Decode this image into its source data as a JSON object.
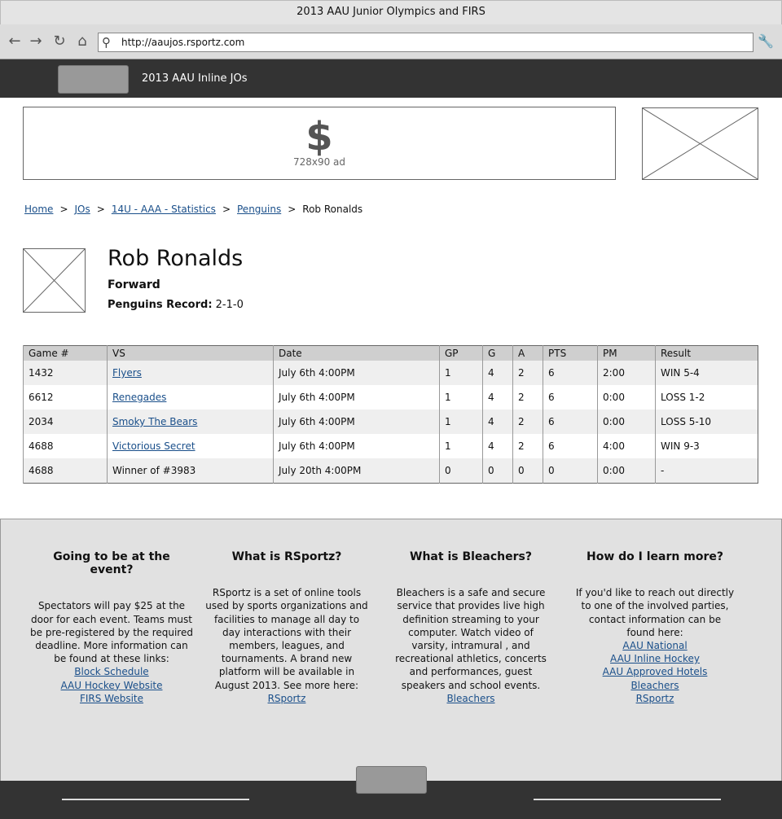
{
  "window": {
    "title": "2013 AAU Junior Olympics and FIRS"
  },
  "browser": {
    "url": "http://aaujos.rsportz.com"
  },
  "header": {
    "app_title": "2013 AAU Inline JOs"
  },
  "ads": {
    "banner_label": "728x90 ad",
    "banner_symbol": "$"
  },
  "breadcrumb": {
    "items": [
      "Home",
      "JOs",
      "14U - AAA - Statistics",
      "Penguins"
    ],
    "current": "Rob Ronalds",
    "separator": ">"
  },
  "player": {
    "name": "Rob Ronalds",
    "position": "Forward",
    "record_label": "Penguins Record:",
    "record_value": "2-1-0"
  },
  "stats_table": {
    "columns": [
      "Game #",
      "VS",
      "Date",
      "GP",
      "G",
      "A",
      "PTS",
      "PM",
      "Result"
    ],
    "rows": [
      [
        "1432",
        "Flyers",
        "July 6th 4:00PM",
        "1",
        "4",
        "2",
        "6",
        "2:00",
        "WIN 5-4"
      ],
      [
        "6612",
        "Renegades",
        "July 6th 4:00PM",
        "1",
        "4",
        "2",
        "6",
        "0:00",
        "LOSS 1-2"
      ],
      [
        "2034",
        "Smoky The Bears",
        "July 6th 4:00PM",
        "1",
        "4",
        "2",
        "6",
        "0:00",
        "LOSS 5-10"
      ],
      [
        "4688",
        "Victorious Secret",
        "July 6th 4:00PM",
        "1",
        "4",
        "2",
        "6",
        "4:00",
        "WIN 9-3"
      ],
      [
        "4688",
        "Winner of #3983",
        "July 20th 4:00PM",
        "0",
        "0",
        "0",
        "0",
        "0:00",
        "-"
      ]
    ]
  },
  "footer": {
    "event": {
      "title": "Going to be at the event?",
      "body": "Spectators will pay $25 at the door for each event.  Teams must be pre-registered by the required deadline.  More information can be found at these links:",
      "links": [
        "Block Schedule",
        "AAU Hockey Website",
        "FIRS Website"
      ]
    },
    "rsportz": {
      "title": "What is RSportz?",
      "body": "RSportz is a set of online tools used by sports organizations and facilities to manage all day to day interactions with their members, leagues, and tournaments.  A brand new platform will be available in August 2013.  See more here:",
      "links": [
        "RSportz"
      ]
    },
    "bleachers": {
      "title": "What is Bleachers?",
      "body": "Bleachers is a safe and secure service that provides live high definition streaming to your computer.  Watch video of varsity, intramural , and recreational athletics, concerts and performances, guest speakers and school events.",
      "links": [
        "Bleachers"
      ]
    },
    "learn": {
      "title": "How do I learn more?",
      "body": "If you'd like to reach out directly to one of the involved parties, contact information can be found here:",
      "links": [
        "AAU National",
        "AAU Inline Hockey",
        "AAU Approved Hotels",
        "Bleachers",
        "RSportz"
      ]
    }
  }
}
